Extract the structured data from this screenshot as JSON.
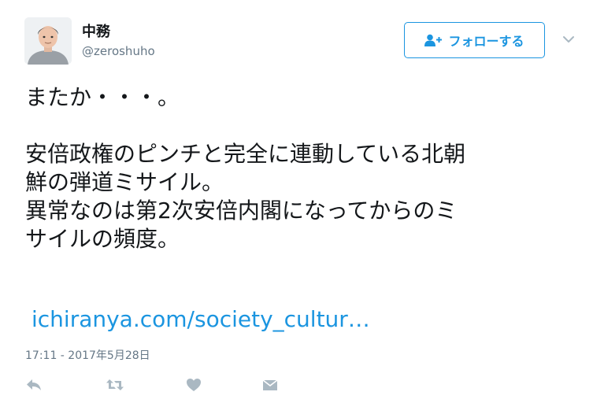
{
  "author": {
    "display_name": "中務",
    "handle": "@zeroshuho"
  },
  "follow_button": {
    "label": "フォローする"
  },
  "tweet": {
    "lines": [
      "またか・・・。",
      "",
      "安倍政権のピンチと完全に連動している北朝",
      "鮮の弾道ミサイル。",
      "異常なのは第2次安倍内閣になってからのミ",
      "サイルの頻度。"
    ],
    "link_text": "ichiranya.com/society_cultur…",
    "timestamp": "17:11 - 2017年5月28日"
  },
  "colors": {
    "accent": "#1b95e0",
    "text": "#14171a",
    "muted": "#657786",
    "icon": "#aab8c2"
  },
  "icons": {
    "follow": "person-plus-icon",
    "caret": "chevron-down-icon",
    "reply": "reply-icon",
    "retweet": "retweet-icon",
    "like": "heart-icon",
    "dm": "envelope-icon"
  }
}
